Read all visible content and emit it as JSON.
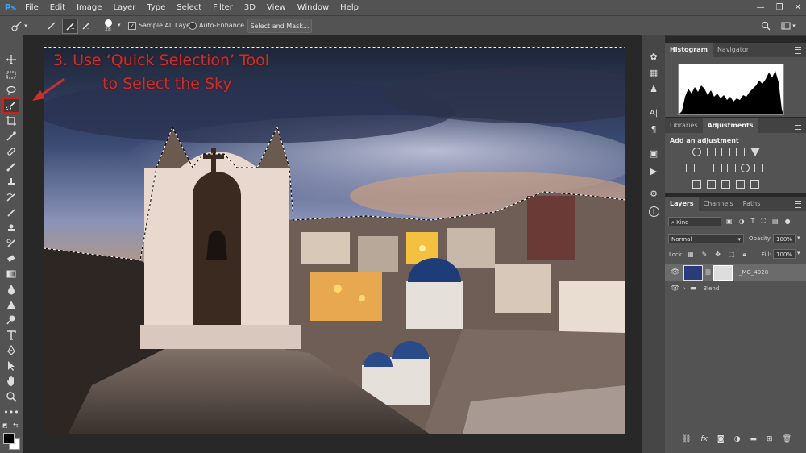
{
  "app": {
    "logo": "Ps"
  },
  "menu": [
    "File",
    "Edit",
    "Image",
    "Layer",
    "Type",
    "Select",
    "Filter",
    "3D",
    "View",
    "Window",
    "Help"
  ],
  "window_controls": {
    "minimize": "—",
    "maximize": "❐",
    "close": "✕"
  },
  "options": {
    "brush_size": "28",
    "sample_all_layers": "Sample All Layers",
    "auto_enhance": "Auto-Enhance",
    "select_and_mask": "Select and Mask..."
  },
  "annotation": {
    "line1": "3. Use ‘Quick Selection’ Tool",
    "line2": "to Select the Sky",
    "color": "#c8302c"
  },
  "histogram_panel": {
    "tabs": [
      "Histogram",
      "Navigator"
    ]
  },
  "adjustments_panel": {
    "tabs": [
      "Libraries",
      "Adjustments"
    ],
    "heading": "Add an adjustment"
  },
  "layers_panel": {
    "tabs": [
      "Layers",
      "Channels",
      "Paths"
    ],
    "kind": "Kind",
    "blend_mode": "Normal",
    "opacity_label": "Opacity:",
    "opacity_value": "100%",
    "lock_label": "Lock:",
    "fill_label": "Fill:",
    "fill_value": "100%",
    "layers": [
      {
        "name": "_MG_4028"
      },
      {
        "name": "Blend"
      }
    ],
    "footer_icons": [
      "link-icon",
      "fx-icon",
      "mask-icon",
      "adjustment-icon",
      "folder-icon",
      "new-layer-icon",
      "trash-icon"
    ]
  },
  "colors": {
    "accent": "#31a8ff",
    "panel": "#535353",
    "canvas_bg": "#282828"
  }
}
